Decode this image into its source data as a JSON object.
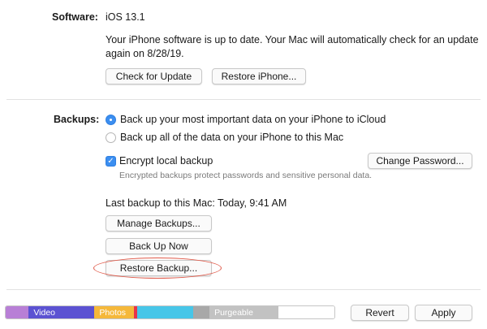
{
  "software": {
    "label": "Software:",
    "version": "iOS 13.1",
    "status_line1": "Your iPhone software is up to date. Your Mac will automatically check for an update",
    "status_line2": "again on 8/28/19.",
    "check_update_label": "Check for Update",
    "restore_iphone_label": "Restore iPhone..."
  },
  "backups": {
    "label": "Backups:",
    "option_icloud": "Back up your most important data on your iPhone to iCloud",
    "option_mac": "Back up all of the data on your iPhone to this Mac",
    "selected_option": "icloud",
    "encrypt_label": "Encrypt local backup",
    "encrypt_checked": true,
    "encrypt_hint": "Encrypted backups protect passwords and sensitive personal data.",
    "change_password_label": "Change Password...",
    "last_backup": "Last backup to this Mac:  Today, 9:41 AM",
    "manage_label": "Manage Backups...",
    "backup_now_label": "Back Up Now",
    "restore_backup_label": "Restore Backup..."
  },
  "storage": {
    "segments": [
      {
        "name": "",
        "color": "#b87fd6",
        "fraction": 0.07
      },
      {
        "name": "Video",
        "color": "#5b52d2",
        "fraction": 0.2
      },
      {
        "name": "Photos",
        "color": "#f5b83a",
        "fraction": 0.12
      },
      {
        "name": "",
        "color": "#e8334a",
        "fraction": 0.01
      },
      {
        "name": "",
        "color": "#47c6e8",
        "fraction": 0.17
      },
      {
        "name": "",
        "color": "#a8a8a8",
        "fraction": 0.05
      },
      {
        "name": "Purgeable",
        "color": "#c2c2c2",
        "fraction": 0.21
      },
      {
        "name": "",
        "color": "#ffffff",
        "fraction": 0.17
      }
    ]
  },
  "footer": {
    "revert_label": "Revert",
    "apply_label": "Apply"
  },
  "colors": {
    "accent": "#3b8ef0",
    "highlight_ring": "#e05a4a"
  }
}
